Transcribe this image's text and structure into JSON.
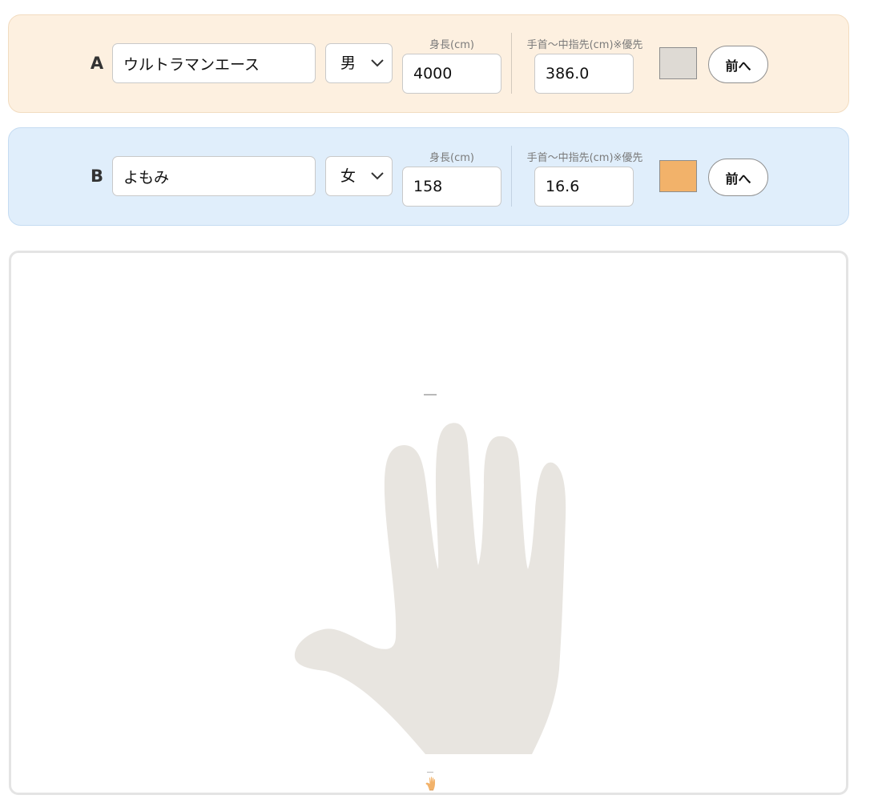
{
  "caption_height": "身長(cm)",
  "caption_hand": "手首〜中指先(cm)※優先",
  "person_a": {
    "label": "A",
    "name": "ウルトラマンエース",
    "sex": "男",
    "height": "4000",
    "hand_length": "386.0",
    "color": "#dedad4",
    "front_button": "前へ"
  },
  "person_b": {
    "label": "B",
    "name": "よもみ",
    "sex": "女",
    "height": "158",
    "hand_length": "16.6",
    "color": "#f2b26a",
    "front_button": "前へ"
  },
  "canvas": {
    "large_hand_color": "#e8e5e0",
    "small_hand_color": "#f2b26a",
    "small_hand_icon": "hand-icon"
  }
}
